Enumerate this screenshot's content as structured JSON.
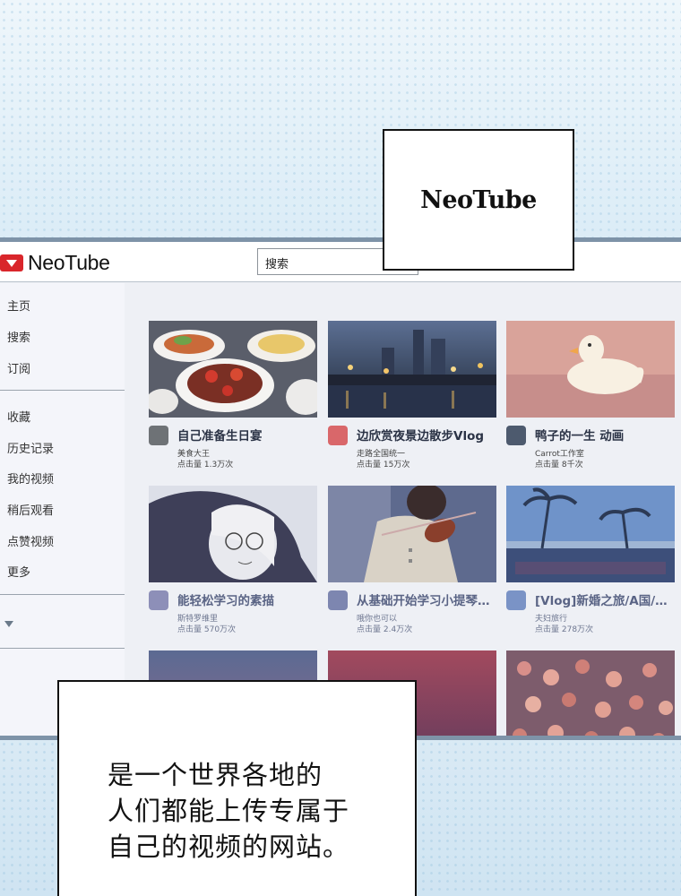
{
  "app": {
    "name": "NeoTube",
    "search_placeholder": "搜索"
  },
  "sidebar": {
    "items": [
      {
        "label": "主页"
      },
      {
        "label": "搜索"
      },
      {
        "label": "订阅"
      },
      {
        "label": "收藏"
      },
      {
        "label": "历史记录"
      },
      {
        "label": "我的视频"
      },
      {
        "label": "稍后观看"
      },
      {
        "label": "点赞视频"
      },
      {
        "label": "更多"
      }
    ]
  },
  "videos": [
    {
      "title": "自己准备生日宴",
      "channel": "美食大王",
      "views": "点击量 1.3万次"
    },
    {
      "title": "边欣赏夜景边散步Vlog",
      "channel": "走路全国统一",
      "views": "点击量 15万次"
    },
    {
      "title": "鸭子的一生 动画",
      "channel": "Carrot工作室",
      "views": "点击量 8千次"
    },
    {
      "title": "能轻松学习的素描",
      "channel": "斯特罗维里",
      "views": "点击量 570万次"
    },
    {
      "title": "从基础开始学习小提琴…",
      "channel": "哦你也可以",
      "views": "点击量 2.4万次"
    },
    {
      "title": "[Vlog]新婚之旅/A国/…",
      "channel": "夫妇旅行",
      "views": "点击量 278万次"
    }
  ],
  "speech": {
    "top": "NeoTube",
    "bottom_lines": [
      "是一个世界各地的",
      "人们都能上传专属于",
      "自己的视频的网站。"
    ]
  },
  "colors": {
    "brand": "#d9262b",
    "frame": "#7e93a8",
    "title_text": "#2b3346"
  }
}
